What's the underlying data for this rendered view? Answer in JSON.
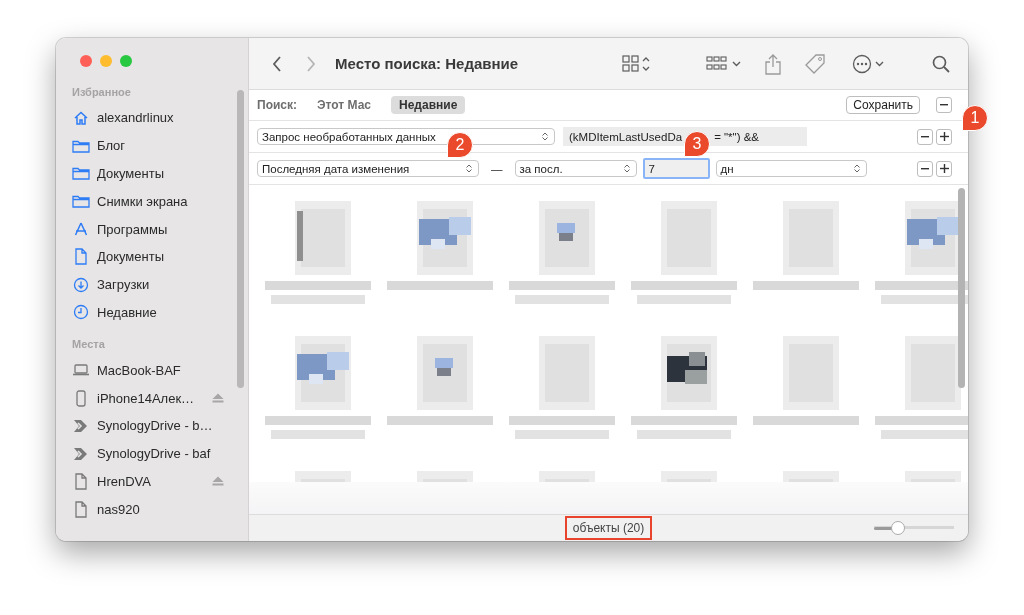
{
  "window": {
    "title": "Место поиска: Недавние"
  },
  "sidebar": {
    "sections": [
      {
        "title": "Избранное",
        "items": [
          {
            "label": "alexandrlinux",
            "kind": "home"
          },
          {
            "label": "Блог",
            "kind": "folder"
          },
          {
            "label": "Документы",
            "kind": "folder"
          },
          {
            "label": "Снимки экрана",
            "kind": "folder"
          },
          {
            "label": "Программы",
            "kind": "apps"
          },
          {
            "label": "Документы",
            "kind": "doc"
          },
          {
            "label": "Загрузки",
            "kind": "download"
          },
          {
            "label": "Недавние",
            "kind": "clock"
          }
        ]
      },
      {
        "title": "Места",
        "items": [
          {
            "label": "MacBook-BAF",
            "kind": "laptop",
            "eject": false
          },
          {
            "label": "iPhone14Алек…",
            "kind": "phone",
            "eject": true
          },
          {
            "label": "SynologyDrive - b…",
            "kind": "synology",
            "eject": false
          },
          {
            "label": "SynologyDrive - baf",
            "kind": "synology",
            "eject": false
          },
          {
            "label": "HrenDVA",
            "kind": "drive",
            "eject": true
          },
          {
            "label": "nas920",
            "kind": "drive",
            "eject": false
          }
        ]
      }
    ]
  },
  "search_bar": {
    "label": "Поиск:",
    "scopes": [
      {
        "label": "Этот Мас",
        "selected": false
      },
      {
        "label": "Недавние",
        "selected": true
      }
    ],
    "save_button": "Сохранить"
  },
  "criteria": [
    {
      "kind": "raw",
      "attribute": "Запрос необработанных данных",
      "query_parts": [
        "(kMDItemLastUsedDa",
        "= \"*\") &&"
      ]
    },
    {
      "kind": "date",
      "attribute": "Последняя дата изменения",
      "separator": "—",
      "operator": "за посл.",
      "value": "7",
      "unit": "дн",
      "focused": true
    }
  ],
  "status_bar": {
    "text": "объекты (20)",
    "highlighted": true,
    "zoom": {
      "level": 0.25
    }
  },
  "callouts": [
    {
      "number": "1"
    },
    {
      "number": "2"
    },
    {
      "number": "3"
    }
  ]
}
